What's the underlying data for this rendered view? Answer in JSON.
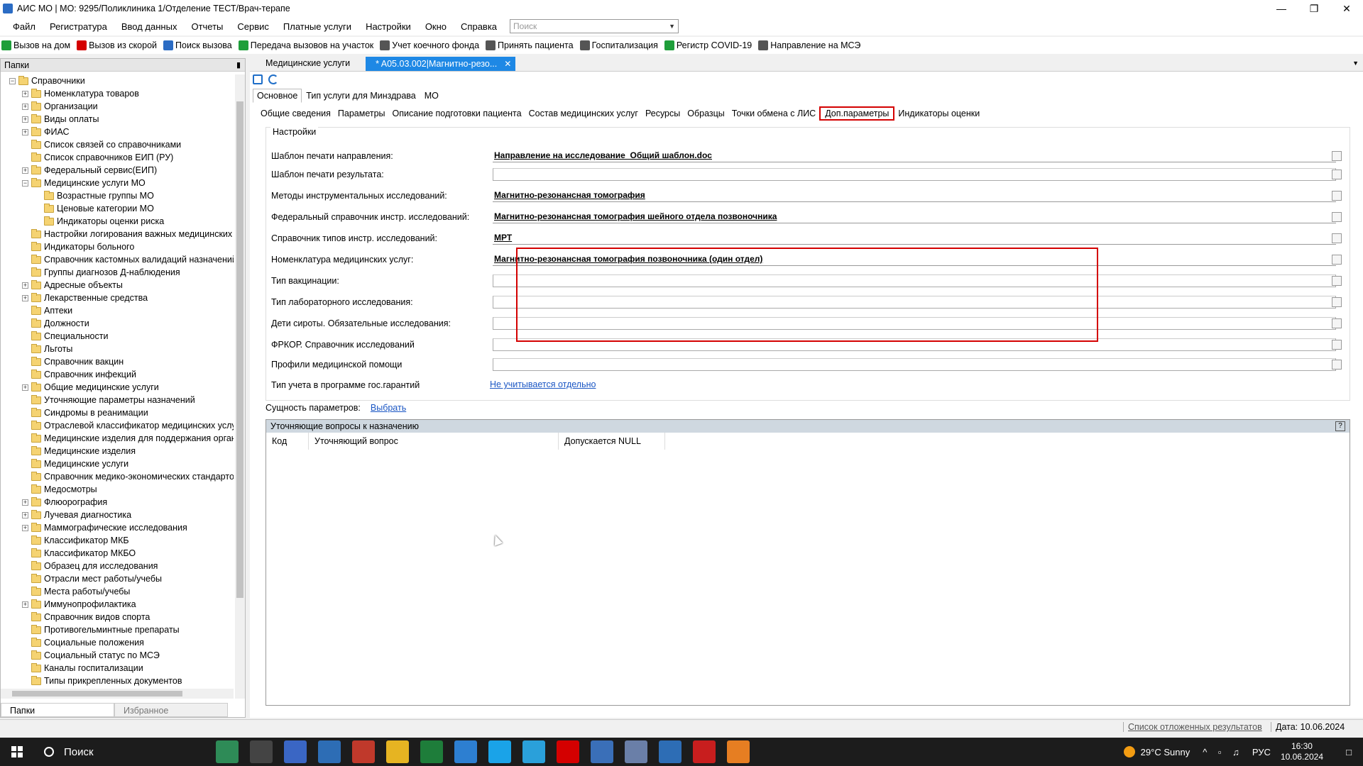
{
  "window": {
    "title": "АИС МО | МО: 9295/Поликлиника 1/Отделение ТЕСТ/Врач-терапе"
  },
  "menu": [
    "Файл",
    "Регистратура",
    "Ввод данных",
    "Отчеты",
    "Сервис",
    "Платные услуги",
    "Настройки",
    "Окно",
    "Справка"
  ],
  "search": {
    "placeholder": "Поиск"
  },
  "toolbar": [
    {
      "label": "Вызов на дом",
      "color": "#1e9e3a"
    },
    {
      "label": "Вызов из скорой",
      "color": "#d40000"
    },
    {
      "label": "Поиск вызова",
      "color": "#2b6cc4"
    },
    {
      "label": "Передача вызовов на участок",
      "color": "#1e9e3a"
    },
    {
      "label": "Учет коечного фонда",
      "color": "#555555"
    },
    {
      "label": "Принять пациента",
      "color": "#555555"
    },
    {
      "label": "Госпитализация",
      "color": "#555555"
    },
    {
      "label": "Регистр COVID-19",
      "color": "#1e9e3a"
    },
    {
      "label": "Направление на МСЭ",
      "color": "#555555"
    }
  ],
  "left_panel": {
    "title": "Папки",
    "tree": [
      {
        "label": "Справочники",
        "level": 0,
        "exp": "−"
      },
      {
        "label": "Номенклатура товаров",
        "level": 1,
        "exp": "+"
      },
      {
        "label": "Организации",
        "level": 1,
        "exp": "+"
      },
      {
        "label": "Виды оплаты",
        "level": 1,
        "exp": "+"
      },
      {
        "label": "ФИАС",
        "level": 1,
        "exp": "+"
      },
      {
        "label": "Список связей со справочниками",
        "level": 1,
        "exp": ""
      },
      {
        "label": "Список справочников ЕИП (РУ)",
        "level": 1,
        "exp": ""
      },
      {
        "label": "Федеральный сервис(ЕИП)",
        "level": 1,
        "exp": "+"
      },
      {
        "label": "Медицинские услуги МО",
        "level": 1,
        "exp": "−"
      },
      {
        "label": "Возрастные группы МО",
        "level": 2,
        "exp": ""
      },
      {
        "label": "Ценовые категории МО",
        "level": 2,
        "exp": ""
      },
      {
        "label": "Индикаторы оценки риска",
        "level": 2,
        "exp": ""
      },
      {
        "label": "Настройки логирования важных медицинских с",
        "level": 1,
        "exp": ""
      },
      {
        "label": "Индикаторы больного",
        "level": 1,
        "exp": ""
      },
      {
        "label": "Справочник кастомных валидаций назначений",
        "level": 1,
        "exp": ""
      },
      {
        "label": "Группы диагнозов Д-наблюдения",
        "level": 1,
        "exp": ""
      },
      {
        "label": "Адресные объекты",
        "level": 1,
        "exp": "+"
      },
      {
        "label": "Лекарственные средства",
        "level": 1,
        "exp": "+"
      },
      {
        "label": "Аптеки",
        "level": 1,
        "exp": ""
      },
      {
        "label": "Должности",
        "level": 1,
        "exp": ""
      },
      {
        "label": "Специальности",
        "level": 1,
        "exp": ""
      },
      {
        "label": "Льготы",
        "level": 1,
        "exp": ""
      },
      {
        "label": "Справочник вакцин",
        "level": 1,
        "exp": ""
      },
      {
        "label": "Справочник инфекций",
        "level": 1,
        "exp": ""
      },
      {
        "label": "Общие медицинские услуги",
        "level": 1,
        "exp": "+"
      },
      {
        "label": "Уточняющие параметры назначений",
        "level": 1,
        "exp": ""
      },
      {
        "label": "Синдромы в реанимации",
        "level": 1,
        "exp": ""
      },
      {
        "label": "Отраслевой классификатор медицинских услуг",
        "level": 1,
        "exp": ""
      },
      {
        "label": "Медицинские изделия для поддержания органи:",
        "level": 1,
        "exp": ""
      },
      {
        "label": "Медицинские изделия",
        "level": 1,
        "exp": ""
      },
      {
        "label": "Медицинские услуги",
        "level": 1,
        "exp": ""
      },
      {
        "label": "Справочник медико-экономических стандартов",
        "level": 1,
        "exp": ""
      },
      {
        "label": "Медосмотры",
        "level": 1,
        "exp": ""
      },
      {
        "label": "Флюорография",
        "level": 1,
        "exp": "+"
      },
      {
        "label": "Лучевая диагностика",
        "level": 1,
        "exp": "+"
      },
      {
        "label": "Маммографические исследования",
        "level": 1,
        "exp": "+"
      },
      {
        "label": "Классификатор МКБ",
        "level": 1,
        "exp": ""
      },
      {
        "label": "Классификатор МКБО",
        "level": 1,
        "exp": ""
      },
      {
        "label": "Образец для исследования",
        "level": 1,
        "exp": ""
      },
      {
        "label": "Отрасли мест работы/учебы",
        "level": 1,
        "exp": ""
      },
      {
        "label": "Места работы/учебы",
        "level": 1,
        "exp": ""
      },
      {
        "label": "Иммунопрофилактика",
        "level": 1,
        "exp": "+"
      },
      {
        "label": "Справочник видов спорта",
        "level": 1,
        "exp": ""
      },
      {
        "label": "Противогельминтные препараты",
        "level": 1,
        "exp": ""
      },
      {
        "label": "Социальные положения",
        "level": 1,
        "exp": ""
      },
      {
        "label": "Социальный статус по МСЭ",
        "level": 1,
        "exp": ""
      },
      {
        "label": "Каналы госпитализации",
        "level": 1,
        "exp": ""
      },
      {
        "label": "Типы прикрепленных документов",
        "level": 1,
        "exp": ""
      }
    ],
    "bottom_tabs": [
      "Папки",
      "Избранное"
    ]
  },
  "doc_tabs": {
    "inactive": "Медицинские услуги",
    "active": "* A05.03.002|Магнитно-резо..."
  },
  "top_tabs": [
    "Основное",
    "Тип услуги для Минздрава",
    "МО"
  ],
  "sub_tabs": [
    "Общие сведения",
    "Параметры",
    "Описание подготовки пациента",
    "Состав медицинских услуг",
    "Ресурсы",
    "Образцы",
    "Точки обмена с ЛИС",
    "Доп.параметры",
    "Индикаторы оценки"
  ],
  "settings": {
    "legend": "Настройки",
    "fields": [
      {
        "label": "Шаблон печати направления:",
        "value": "Направление на исследование_Общий шаблон.doc"
      },
      {
        "label": "Шаблон печати результата:",
        "value": ""
      },
      {
        "label": "Методы инструментальных исследований:",
        "value": "Магнитно-резонансная томография"
      },
      {
        "label": "Федеральный справочник инстр. исследований:",
        "value": "Магнитно-резонансная томография шейного отдела позвоночника"
      },
      {
        "label": "Справочник типов инстр. исследований:",
        "value": "МРТ"
      },
      {
        "label": "Номенклатура медицинских услуг:",
        "value": "Магнитно-резонансная томография позвоночника (один отдел)"
      },
      {
        "label": "Тип вакцинации:",
        "value": ""
      },
      {
        "label": "Тип лабораторного исследования:",
        "value": ""
      },
      {
        "label": "Дети сироты. Обязательные исследования:",
        "value": ""
      },
      {
        "label": "ФРКОР. Справочник исследований",
        "value": ""
      },
      {
        "label": "Профили медицинской помощи",
        "value": ""
      }
    ],
    "gos_label": "Тип учета в программе гос.гарантий",
    "gos_value": "Не учитывается отдельно"
  },
  "entity": {
    "label": "Сущность параметров:",
    "link": "Выбрать"
  },
  "grid": {
    "title": "Уточняющие вопросы к назначению",
    "columns": [
      "Код",
      "Уточняющий вопрос",
      "Допускается NULL"
    ]
  },
  "statusbar": {
    "link": "Список отложенных результатов",
    "date": "Дата: 10.06.2024"
  },
  "taskbar": {
    "search": "Поиск",
    "weather": "29°C  Sunny",
    "lang": "РУС",
    "time": "16:30",
    "date": "10.06.2024"
  }
}
